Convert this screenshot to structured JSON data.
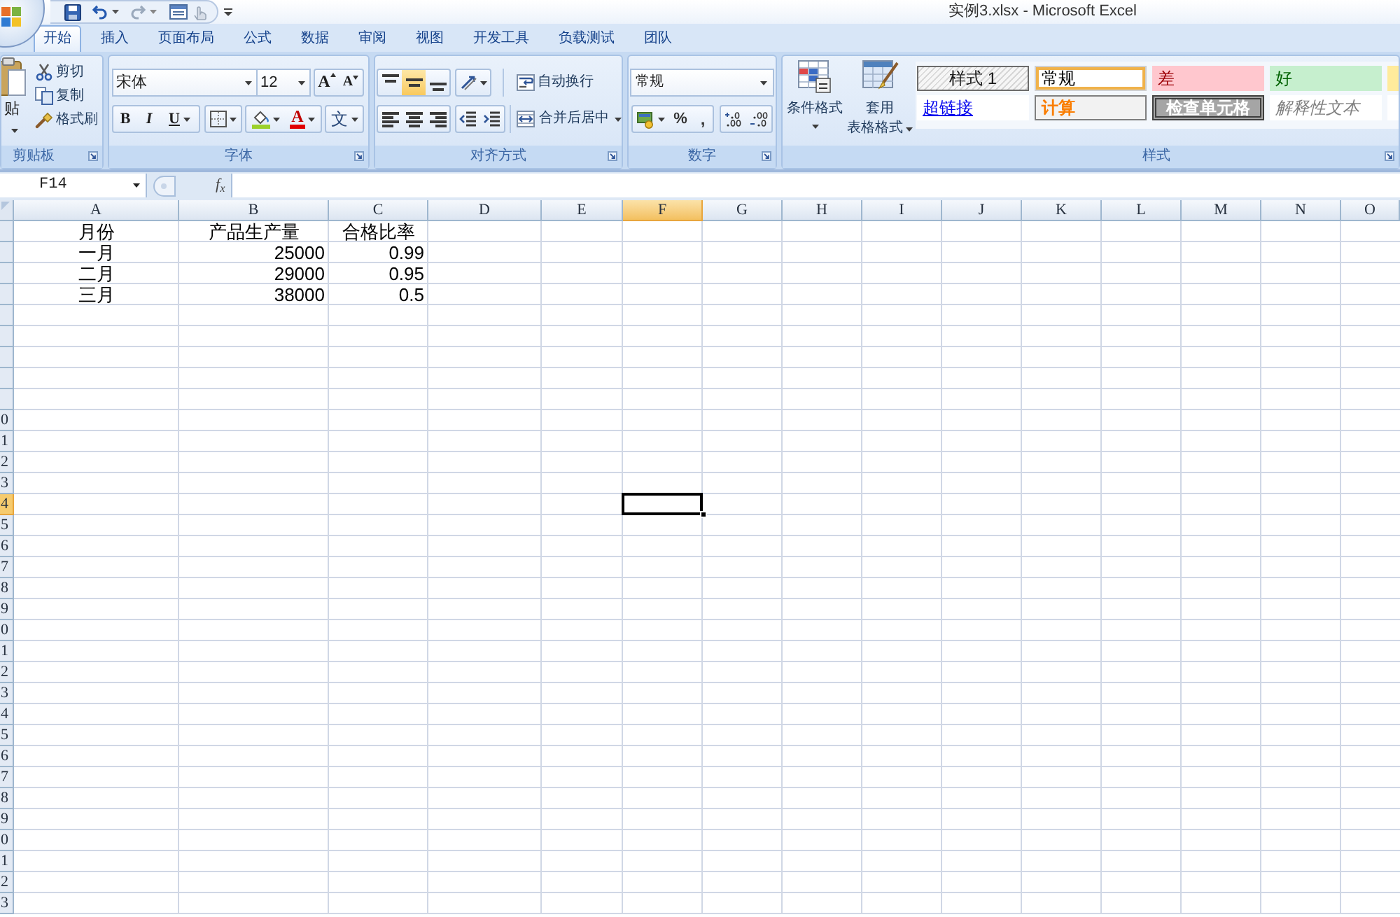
{
  "title_bar": {
    "title": "实例3.xlsx - Microsoft Excel"
  },
  "tabs": [
    {
      "label": "开始",
      "selected": true
    },
    {
      "label": "插入",
      "selected": false
    },
    {
      "label": "页面布局",
      "selected": false
    },
    {
      "label": "公式",
      "selected": false
    },
    {
      "label": "数据",
      "selected": false
    },
    {
      "label": "审阅",
      "selected": false
    },
    {
      "label": "视图",
      "selected": false
    },
    {
      "label": "开发工具",
      "selected": false
    },
    {
      "label": "负载测试",
      "selected": false
    },
    {
      "label": "团队",
      "selected": false
    }
  ],
  "clipboard": {
    "label": "剪贴板",
    "paste": "贴",
    "commands": [
      {
        "kind": "cut",
        "label": "剪切"
      },
      {
        "kind": "copy",
        "label": "复制"
      },
      {
        "kind": "format_painter",
        "label": "格式刷"
      }
    ]
  },
  "font": {
    "label": "字体",
    "font_name": "宋体",
    "font_size": "12",
    "grow": "A",
    "shrink": "A",
    "styles": [
      {
        "kind": "bold",
        "label": "B"
      },
      {
        "kind": "italic",
        "label": "I"
      },
      {
        "kind": "underline",
        "label": "U"
      }
    ],
    "font_color": "A",
    "phonetic": "文"
  },
  "alignment": {
    "label": "对齐方式",
    "vertical": [
      {
        "kind": "top",
        "selected": false
      },
      {
        "kind": "middle",
        "selected": true
      },
      {
        "kind": "bottom",
        "selected": false
      }
    ],
    "horizontal": [
      {
        "kind": "left",
        "selected": false
      },
      {
        "kind": "center",
        "selected": false
      },
      {
        "kind": "right",
        "selected": false
      }
    ],
    "wrap_text": "自动换行",
    "merge_center": "合并后居中"
  },
  "number": {
    "label": "数字",
    "format": "常规",
    "percent": "%",
    "comma": ","
  },
  "styles": {
    "label": "样式",
    "conditional_formatting": "条件格式",
    "format_as_table": [
      "套用",
      "表格格式"
    ],
    "gallery": [
      {
        "kind": "style1",
        "label": "样式 1",
        "selected": false
      },
      {
        "kind": "normal",
        "label": "常规",
        "selected": true
      },
      {
        "kind": "bad",
        "label": "差",
        "selected": false
      },
      {
        "kind": "good",
        "label": "好",
        "selected": false
      },
      {
        "kind": "neutral",
        "selected": false
      },
      {
        "kind": "hyperlink",
        "label": "超链接",
        "selected": false
      },
      {
        "kind": "calculation",
        "label": "计算",
        "selected": false
      },
      {
        "kind": "check",
        "label": "检查单元格",
        "selected": false
      },
      {
        "kind": "explanatory",
        "label": "解释性文本",
        "selected": false
      },
      {
        "kind": "warning",
        "selected": false
      }
    ]
  },
  "formula_bar": {
    "name_box": "F14",
    "function_label": "f$_{x}$"
  },
  "sheet": {
    "columns": [
      {
        "label": "A",
        "selected": false
      },
      {
        "label": "B",
        "selected": false
      },
      {
        "label": "C",
        "selected": false
      },
      {
        "label": "D",
        "selected": false
      },
      {
        "label": "E",
        "selected": false
      },
      {
        "label": "F",
        "selected": true
      },
      {
        "label": "G",
        "selected": false
      },
      {
        "label": "H",
        "selected": false
      },
      {
        "label": "I",
        "selected": false
      },
      {
        "label": "J",
        "selected": false
      },
      {
        "label": "K",
        "selected": false
      },
      {
        "label": "L",
        "selected": false
      },
      {
        "label": "M",
        "selected": false
      },
      {
        "label": "N",
        "selected": false
      },
      {
        "label": "O",
        "selected": false
      }
    ],
    "rows": [
      {
        "selected": false,
        "cells": [
          {
            "text": "月份",
            "kind": "text"
          },
          {
            "text": "产品生产量",
            "kind": "text"
          },
          {
            "text": "合格比率",
            "kind": "text"
          }
        ]
      },
      {
        "selected": false,
        "cells": [
          {
            "text": "一月",
            "kind": "text"
          },
          {
            "text": "25000",
            "kind": "number"
          },
          {
            "text": "0.99",
            "kind": "number"
          }
        ]
      },
      {
        "selected": false,
        "cells": [
          {
            "text": "二月",
            "kind": "text"
          },
          {
            "text": "29000",
            "kind": "number"
          },
          {
            "text": "0.95",
            "kind": "number"
          }
        ]
      },
      {
        "selected": false,
        "cells": [
          {
            "text": "三月",
            "kind": "text"
          },
          {
            "text": "38000",
            "kind": "number"
          },
          {
            "text": "0.5",
            "kind": "number"
          }
        ]
      },
      {
        "selected": false
      },
      {
        "selected": false
      },
      {
        "selected": false
      },
      {
        "selected": false
      },
      {
        "selected": false
      },
      {
        "header": "0",
        "selected": false
      },
      {
        "header": "1",
        "selected": false
      },
      {
        "header": "2",
        "selected": false
      },
      {
        "header": "3",
        "selected": false
      },
      {
        "header": "4",
        "selected": true
      },
      {
        "header": "5",
        "selected": false
      },
      {
        "header": "6",
        "selected": false
      },
      {
        "header": "7",
        "selected": false
      },
      {
        "header": "8",
        "selected": false
      },
      {
        "header": "9",
        "selected": false
      },
      {
        "header": "0",
        "selected": false
      },
      {
        "header": "1",
        "selected": false
      },
      {
        "header": "2",
        "selected": false
      },
      {
        "header": "3",
        "selected": false
      },
      {
        "header": "4",
        "selected": false
      },
      {
        "header": "5",
        "selected": false
      },
      {
        "header": "6",
        "selected": false
      },
      {
        "header": "7",
        "selected": false
      },
      {
        "header": "8",
        "selected": false
      },
      {
        "header": "9",
        "selected": false
      },
      {
        "header": "0",
        "selected": false
      },
      {
        "header": "1",
        "selected": false
      },
      {
        "header": "2",
        "selected": false
      },
      {
        "header": "3",
        "selected": false
      }
    ]
  }
}
